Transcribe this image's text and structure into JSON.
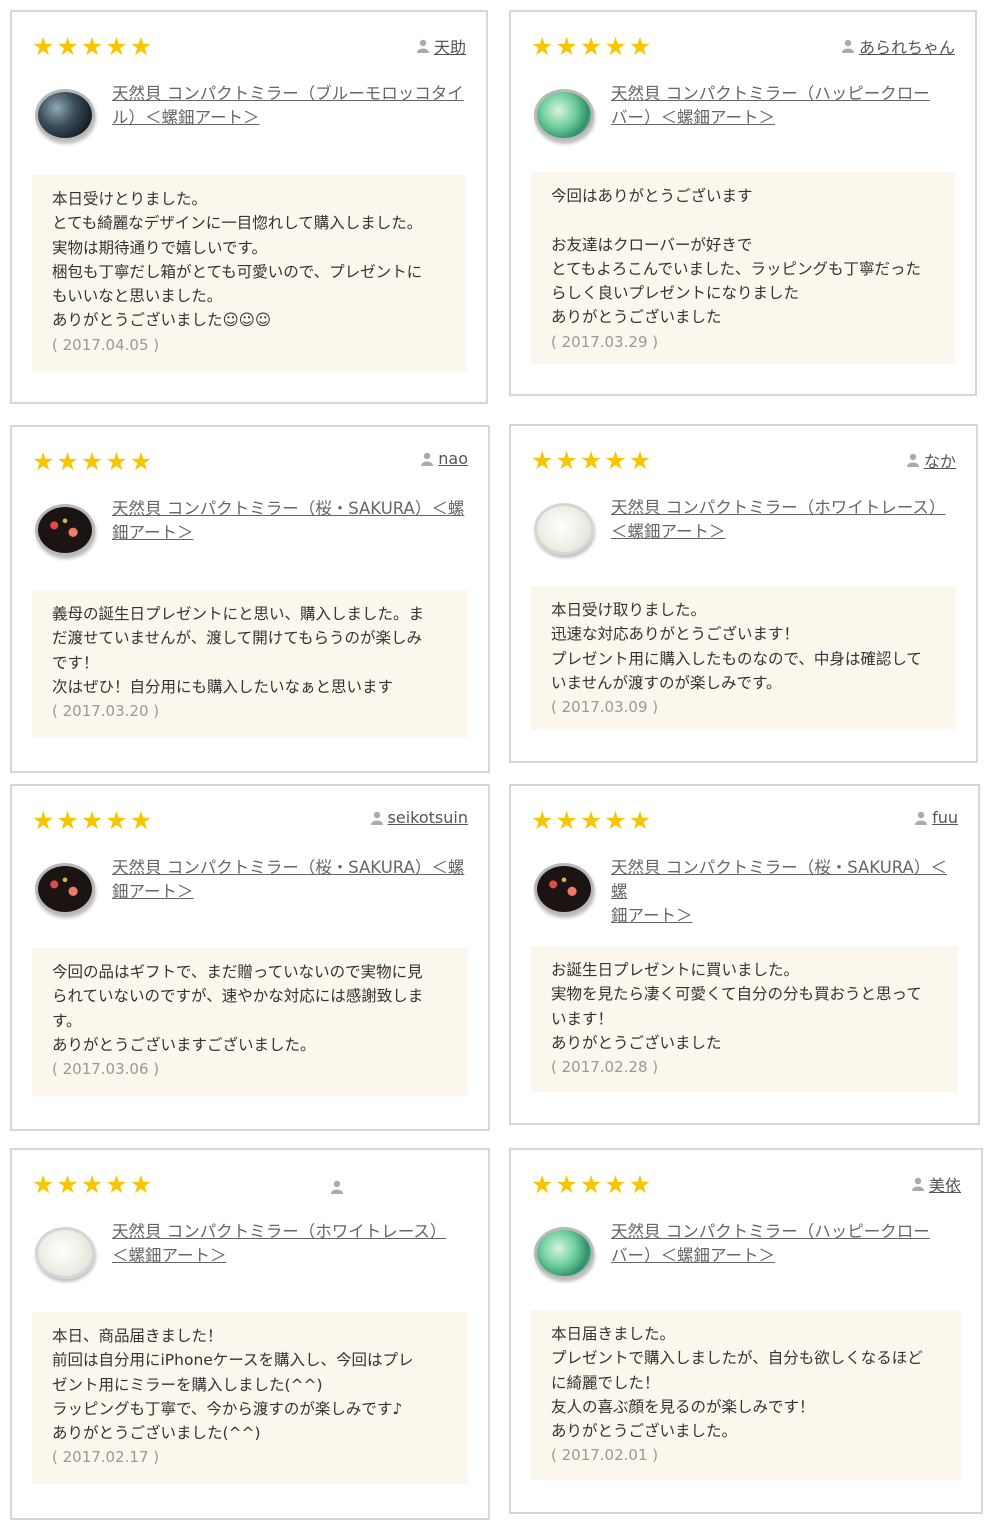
{
  "reviews": [
    {
      "stars": 5,
      "user": "天助",
      "product_line1": "天然貝 コンパクトミラー（ブルーモロッコタイ",
      "product_line2": "ル）＜螺鈿アート＞",
      "thumb": "blue-moroccan-mirror",
      "lines": [
        "本日受けとりました。",
        "とても綺麗なデザインに一目惚れして購入しました。",
        "実物は期待通りで嬉しいです。",
        "梱包も丁寧だし箱がとても可愛いので、プレゼントに",
        "もいいなと思いました。",
        "ありがとうございました☺☺☺"
      ],
      "date": "( 2017.04.05 )"
    },
    {
      "stars": 5,
      "user": "あられちゃん",
      "product_line1": "天然貝 コンパクトミラー（ハッピークロー",
      "product_line2": "バー）＜螺鈿アート＞",
      "thumb": "happy-clover-mirror",
      "lines": [
        "今回はありがとうございます",
        "",
        "お友達はクローバーが好きで",
        "とてもよろこんでいました、ラッピングも丁寧だった",
        "らしく良いプレゼントになりました",
        "ありがとうございました"
      ],
      "date": "( 2017.03.29 )"
    },
    {
      "stars": 5,
      "user": "nao",
      "product_line1": "天然貝 コンパクトミラー（桜・SAKURA）＜螺",
      "product_line2": "鈿アート＞",
      "thumb": "sakura-mirror",
      "lines": [
        "義母の誕生日プレゼントにと思い、購入しました。ま",
        "だ渡せていませんが、渡して開けてもらうのが楽しみ",
        "です！",
        "次はぜひ！自分用にも購入したいなぁと思います"
      ],
      "date": "( 2017.03.20 )"
    },
    {
      "stars": 5,
      "user": "なか",
      "product_line1": "天然貝 コンパクトミラー（ホワイトレース）",
      "product_line2": "＜螺鈿アート＞",
      "thumb": "white-lace-mirror",
      "lines": [
        "本日受け取りました。",
        "迅速な対応ありがとうございます！",
        "プレゼント用に購入したものなので、中身は確認して",
        "いませんが渡すのが楽しみです。"
      ],
      "date": "( 2017.03.09 )"
    },
    {
      "stars": 5,
      "user": "seikotsuin",
      "product_line1": "天然貝 コンパクトミラー（桜・SAKURA）＜螺",
      "product_line2": "鈿アート＞",
      "thumb": "sakura-mirror",
      "lines": [
        "今回の品はギフトで、まだ贈っていないので実物に見",
        "られていないのですが、速やかな対応には感謝致しま",
        "す。",
        "ありがとうございますございました。"
      ],
      "date": "( 2017.03.06 )"
    },
    {
      "stars": 5,
      "user": "fuu",
      "product_line1": "天然貝 コンパクトミラー（桜・SAKURA）＜螺",
      "product_line2": "鈿アート＞",
      "thumb": "sakura-mirror",
      "lines": [
        "お誕生日プレゼントに買いました。",
        "実物を見たら凄く可愛くて自分の分も買おうと思って",
        "います！",
        "ありがとうございました"
      ],
      "date": "( 2017.02.28 )"
    },
    {
      "stars": 5,
      "user": "",
      "product_line1": "天然貝 コンパクトミラー（ホワイトレース）",
      "product_line2": "＜螺鈿アート＞",
      "thumb": "white-lace-mirror",
      "lines": [
        "本日、商品届きました！",
        "前回は自分用にiPhoneケースを購入し、今回はプレ",
        "ゼント用にミラーを購入しました(^^)",
        "ラッピングも丁寧で、今から渡すのが楽しみです♪",
        "ありがとうございました(^^)"
      ],
      "date": "( 2017.02.17 )"
    },
    {
      "stars": 5,
      "user": "美依",
      "product_line1": "天然貝 コンパクトミラー（ハッピークロー",
      "product_line2": "バー）＜螺鈿アート＞",
      "thumb": "happy-clover-mirror",
      "lines": [
        "本日届きました。",
        "プレゼントで購入しましたが、自分も欲しくなるほど",
        "に綺麗でした！",
        "友人の喜ぶ顔を見るのが楽しみです！",
        "ありがとうございました。"
      ],
      "date": "( 2017.02.01 )"
    }
  ],
  "colors": {
    "star": "#f7c600",
    "body_bg": "#fcf7ec",
    "border": "#d6d6d6",
    "date": "#999999"
  },
  "icons": {
    "star": "star-icon",
    "user": "user-icon"
  }
}
